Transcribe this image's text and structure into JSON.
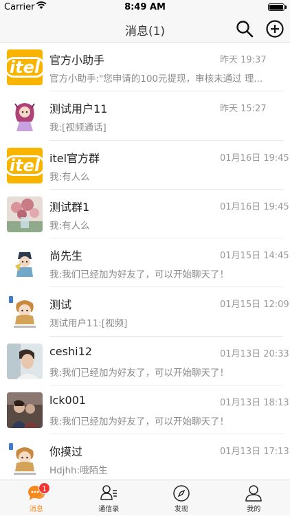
{
  "status_bar": {
    "carrier": "Carrier",
    "time": "8:49 AM"
  },
  "nav": {
    "title": "消息(1)",
    "search_icon": "search-icon",
    "add_icon": "plus-circle-icon"
  },
  "conversations": [
    {
      "name": "官方小助手",
      "time": "昨天 19:37",
      "preview": "官方小助手:\"您申请的100元提现，审核未通过  理...",
      "avatar": "itel-logo"
    },
    {
      "name": "测试用户11",
      "time": "昨天 15:27",
      "preview": "我:[视频通话]",
      "avatar": "anime-girl"
    },
    {
      "name": "itel官方群",
      "time": "01月16日 19:45",
      "preview": "我:有人么",
      "avatar": "itel-logo"
    },
    {
      "name": "测试群1",
      "time": "01月16日 19:45",
      "preview": "我:有人么",
      "avatar": "flowers-photo"
    },
    {
      "name": "尚先生",
      "time": "01月15日 14:45",
      "preview": "我:我们已经加为好友了，可以开始聊天了！",
      "avatar": "cartoon-warrior"
    },
    {
      "name": "测试",
      "time": "01月15日 12:09",
      "preview": "测试用户11:[视频]",
      "avatar": "cartoon-monk"
    },
    {
      "name": "ceshi12",
      "time": "01月13日 20:33",
      "preview": "我:我们已经加为好友了，可以开始聊天了！",
      "avatar": "boy-photo"
    },
    {
      "name": "lck001",
      "time": "01月13日 18:13",
      "preview": "我:我们已经加为好友了，可以开始聊天了！",
      "avatar": "couple-photo"
    },
    {
      "name": "你摸过",
      "time": "01月13日 17:13",
      "preview": "Hdjhh:哦陌生",
      "avatar": "cartoon-monk"
    }
  ],
  "tabs": [
    {
      "label": "消息",
      "icon": "chat-bubbles-icon",
      "active": true,
      "badge": "1"
    },
    {
      "label": "通信录",
      "icon": "contacts-icon",
      "active": false
    },
    {
      "label": "发现",
      "icon": "compass-icon",
      "active": false
    },
    {
      "label": "我的",
      "icon": "person-icon",
      "active": false
    }
  ],
  "colors": {
    "accent": "#f5891f",
    "badge": "#f43530",
    "itel_yellow": "#f9b400"
  }
}
